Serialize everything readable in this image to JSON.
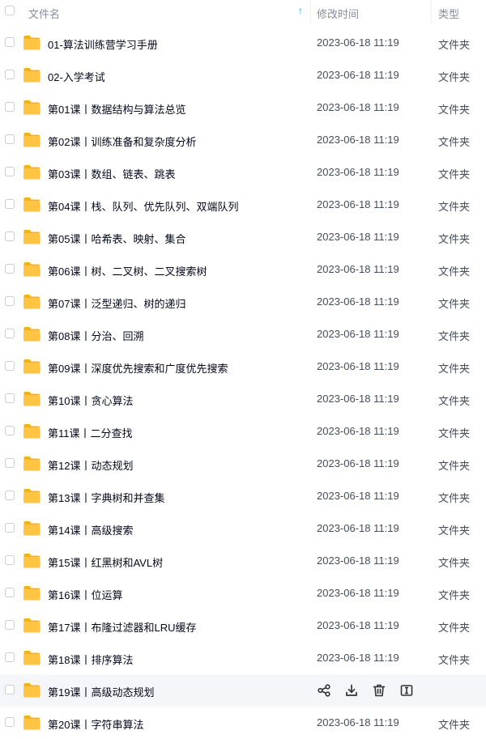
{
  "header": {
    "name_label": "文件名",
    "time_label": "修改时间",
    "type_label": "类型",
    "sort_arrow": "↑"
  },
  "rows": [
    {
      "name": "01-算法训练营学习手册",
      "time": "2023-06-18 11:19",
      "type": "文件夹"
    },
    {
      "name": "02-入学考试",
      "time": "2023-06-18 11:19",
      "type": "文件夹"
    },
    {
      "name": "第01课丨数据结构与算法总览",
      "time": "2023-06-18 11:19",
      "type": "文件夹"
    },
    {
      "name": "第02课丨训练准备和复杂度分析",
      "time": "2023-06-18 11:19",
      "type": "文件夹"
    },
    {
      "name": "第03课丨数组、链表、跳表",
      "time": "2023-06-18 11:19",
      "type": "文件夹"
    },
    {
      "name": "第04课丨栈、队列、优先队列、双端队列",
      "time": "2023-06-18 11:19",
      "type": "文件夹"
    },
    {
      "name": "第05课丨哈希表、映射、集合",
      "time": "2023-06-18 11:19",
      "type": "文件夹"
    },
    {
      "name": "第06课丨树、二叉树、二叉搜索树",
      "time": "2023-06-18 11:19",
      "type": "文件夹"
    },
    {
      "name": "第07课丨泛型递归、树的递归",
      "time": "2023-06-18 11:19",
      "type": "文件夹"
    },
    {
      "name": "第08课丨分治、回溯",
      "time": "2023-06-18 11:19",
      "type": "文件夹"
    },
    {
      "name": "第09课丨深度优先搜索和广度优先搜索",
      "time": "2023-06-18 11:19",
      "type": "文件夹"
    },
    {
      "name": "第10课丨贪心算法",
      "time": "2023-06-18 11:19",
      "type": "文件夹"
    },
    {
      "name": "第11课丨二分查找",
      "time": "2023-06-18 11:19",
      "type": "文件夹"
    },
    {
      "name": "第12课丨动态规划",
      "time": "2023-06-18 11:19",
      "type": "文件夹"
    },
    {
      "name": "第13课丨字典树和并查集",
      "time": "2023-06-18 11:19",
      "type": "文件夹"
    },
    {
      "name": "第14课丨高级搜索",
      "time": "2023-06-18 11:19",
      "type": "文件夹"
    },
    {
      "name": "第15课丨红黑树和AVL树",
      "time": "2023-06-18 11:19",
      "type": "文件夹"
    },
    {
      "name": "第16课丨位运算",
      "time": "2023-06-18 11:19",
      "type": "文件夹"
    },
    {
      "name": "第17课丨布隆过滤器和LRU缓存",
      "time": "2023-06-18 11:19",
      "type": "文件夹"
    },
    {
      "name": "第18课丨排序算法",
      "time": "2023-06-18 11:19",
      "type": "文件夹"
    },
    {
      "name": "第19课丨高级动态规划",
      "hover": true,
      "actions": [
        "share-icon",
        "download-icon",
        "delete-icon",
        "rename-icon"
      ]
    },
    {
      "name": "第20课丨字符串算法",
      "time": "2023-06-18 11:19",
      "type": "文件夹"
    }
  ],
  "colors": {
    "accent": "#06a7ff",
    "folder": "#ffc542",
    "hover_bg": "#f5f6fa"
  }
}
